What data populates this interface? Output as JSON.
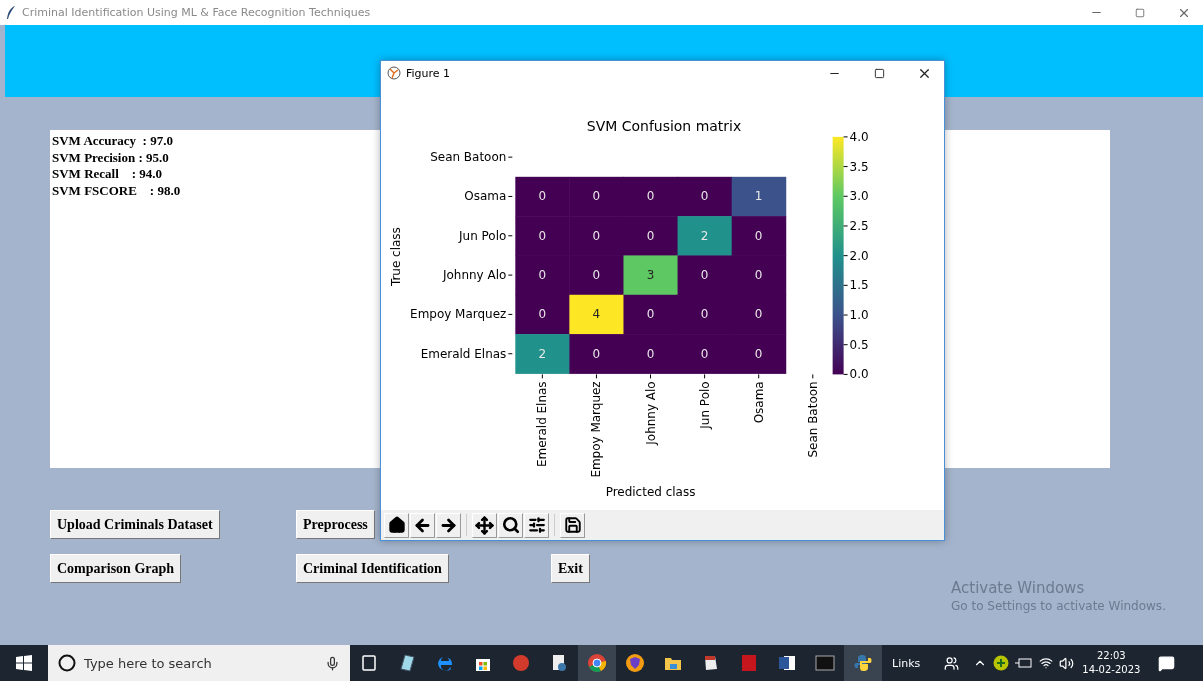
{
  "window": {
    "title": "Criminal Identification Using ML & Face Recognition Techniques"
  },
  "results": [
    "SVM Accuracy  : 97.0",
    "SVM Precision : 95.0",
    "SVM Recall    : 94.0",
    "SVM FSCORE    : 98.0"
  ],
  "buttons": [
    [
      "Upload Criminals Dataset",
      "Preprocess"
    ],
    [
      "Comparison Graph",
      "Criminal Identification",
      "Exit"
    ]
  ],
  "figure": {
    "title": "Figure 1",
    "confusion_matrix": {
      "title": "SVM Confusion matrix",
      "xlabel": "Predicted class",
      "ylabel": "True class",
      "columns": [
        "Emerald Elnas",
        "Empoy Marquez",
        "Johnny Alo",
        "Jun Polo",
        "Osama",
        "Sean Batoon"
      ],
      "rows": [
        {
          "label": "Sean Batoon"
        },
        {
          "label": "Osama",
          "cells": [
            "0",
            "0",
            "0",
            "0",
            "1"
          ]
        },
        {
          "label": "Jun Polo",
          "cells": [
            "0",
            "0",
            "0",
            "2",
            "0"
          ]
        },
        {
          "label": "Johnny Alo",
          "cells": [
            "0",
            "0",
            "3",
            "0",
            "0"
          ]
        },
        {
          "label": "Empoy Marquez",
          "cells": [
            "0",
            "4",
            "0",
            "0",
            "0"
          ]
        },
        {
          "label": "Emerald Elnas",
          "cells": [
            "2",
            "0",
            "0",
            "0",
            "0"
          ]
        }
      ],
      "colorbar_ticks": [
        "4.0",
        "3.5",
        "3.0",
        "2.5",
        "2.0",
        "1.5",
        "1.0",
        "0.5",
        "0.0"
      ]
    }
  },
  "watermark": {
    "title": "Activate Windows",
    "subtitle": "Go to Settings to activate Windows."
  },
  "taskbar": {
    "search": {
      "placeholder": "Type here to search"
    },
    "links": "Links",
    "time": "22:03",
    "date": "14-02-2023"
  }
}
